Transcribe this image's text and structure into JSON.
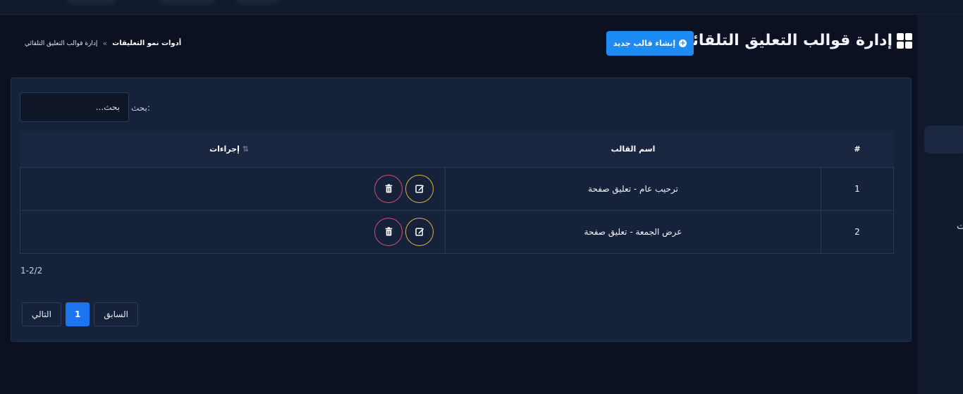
{
  "header": {
    "title": "إدارة قوالب التعليق التلقائي",
    "title_icon": "grid-icon",
    "create_button": "إنشاء قالب جديد",
    "create_icon": "plus-circle-icon"
  },
  "breadcrumb": {
    "parent": "أدوات نمو التعليقات",
    "separator": "»",
    "current": "إدارة قوالب التعليق التلقائي"
  },
  "search": {
    "label": "بحث:",
    "placeholder": "بحث..."
  },
  "table": {
    "columns": [
      "#",
      "اسم القالب",
      "إجراءات"
    ],
    "rows": [
      {
        "index": "1",
        "name": "ترحيب عام - تعليق صفحة"
      },
      {
        "index": "2",
        "name": "عرض الجمعة - تعليق صفحة"
      }
    ]
  },
  "pagination": {
    "range": "1-2/2",
    "prev": "السابق",
    "current": "1",
    "next": "التالي"
  },
  "sidebar": {
    "partial_label": "ت"
  },
  "colors": {
    "accent": "#1d8bf4",
    "delete_border": "#d0516a",
    "edit_border": "#d4b43a",
    "card_bg": "#16213a"
  }
}
